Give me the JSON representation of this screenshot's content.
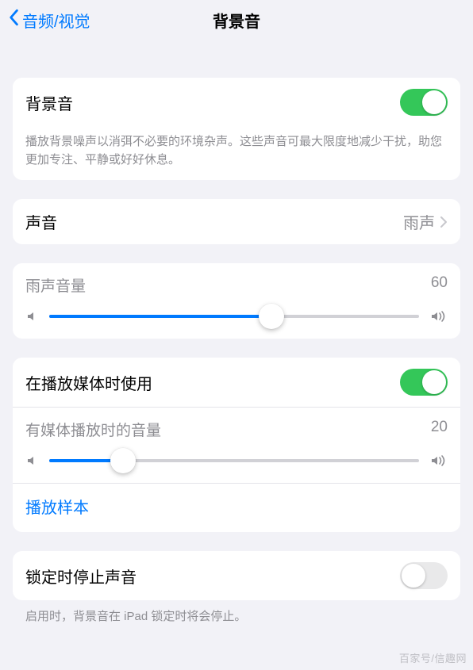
{
  "header": {
    "back_label": "音频/视觉",
    "title": "背景音"
  },
  "section_main": {
    "toggle_label": "背景音",
    "toggle_on": true,
    "description": "播放背景噪声以消弭不必要的环境杂声。这些声音可最大限度地减少干扰，助您更加专注、平静或好好休息。"
  },
  "section_sound": {
    "label": "声音",
    "value": "雨声"
  },
  "section_volume": {
    "label": "雨声音量",
    "value": 60
  },
  "section_media": {
    "toggle_label": "在播放媒体时使用",
    "toggle_on": true,
    "volume_label": "有媒体播放时的音量",
    "volume_value": 20,
    "sample_label": "播放样本"
  },
  "section_lock": {
    "toggle_label": "锁定时停止声音",
    "toggle_on": false,
    "description": "启用时，背景音在 iPad 锁定时将会停止。"
  },
  "watermark": "百家号/信趣网"
}
